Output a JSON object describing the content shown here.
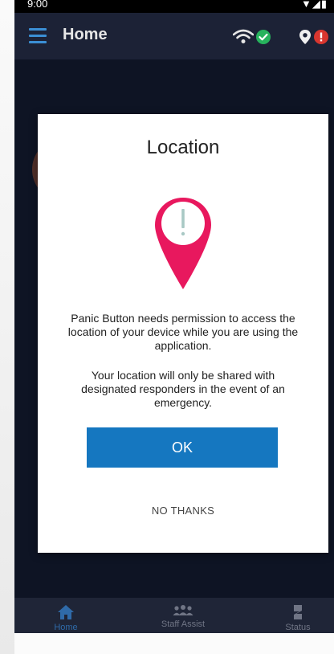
{
  "status_bar": {
    "time": "9:00",
    "icons": "▼◢▮"
  },
  "header": {
    "title": "Home"
  },
  "dialog": {
    "title": "Location",
    "message_permission": "Panic Button needs permission to access the location of your device while you are using the application.",
    "message_sharing": "Your location will only be shared with designated responders in the event of an emergency.",
    "ok_label": "OK",
    "no_thanks_label": "NO THANKS"
  },
  "bottom_nav": {
    "items": [
      {
        "label": "Home",
        "icon": "home-icon",
        "active": true
      },
      {
        "label": "Staff Assist",
        "icon": "staff-assist-icon",
        "active": false
      },
      {
        "label": "Status",
        "icon": "status-icon",
        "active": false
      }
    ]
  },
  "colors": {
    "accent": "#1577c0",
    "pin": "#e8185e",
    "header_bg": "#1c2236",
    "screen_bg": "#0e1424",
    "ok_status": "#27b35d",
    "alert": "#d9362f"
  }
}
